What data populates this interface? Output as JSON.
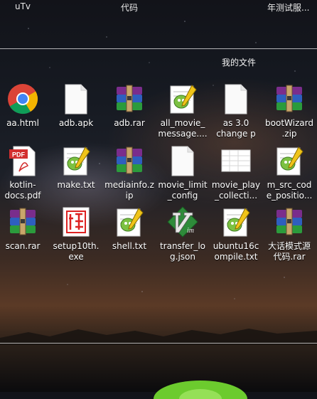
{
  "top": {
    "left_label": "uTv",
    "center_label": "代码",
    "right_label": "年测试服..."
  },
  "folder": {
    "title": "我的文件"
  },
  "files": [
    {
      "label": "aa.html",
      "icon": "chrome-icon"
    },
    {
      "label": "adb.apk",
      "icon": "document-icon"
    },
    {
      "label": "adb.rar",
      "icon": "winrar-icon"
    },
    {
      "label": "all_movie_message....",
      "icon": "notepadpp-icon"
    },
    {
      "label": "as 3.0 change p",
      "icon": "document-icon"
    },
    {
      "label": "bootWizard.zip",
      "icon": "winrar-icon"
    },
    {
      "label": "kotlin-docs.pdf",
      "icon": "pdf-icon"
    },
    {
      "label": "make.txt",
      "icon": "notepadpp-icon"
    },
    {
      "label": "mediainfo.zip",
      "icon": "winrar-icon"
    },
    {
      "label": "movie_limit_config",
      "icon": "document-icon"
    },
    {
      "label": "movie_play_collecti...",
      "icon": "spreadsheet-icon"
    },
    {
      "label": "m_src_code_positio...",
      "icon": "notepadpp-icon"
    },
    {
      "label": "scan.rar",
      "icon": "winrar-icon"
    },
    {
      "label": "setup10th.exe",
      "icon": "seal-icon"
    },
    {
      "label": "shell.txt",
      "icon": "notepadpp-icon"
    },
    {
      "label": "transfer_log.json",
      "icon": "vim-icon"
    },
    {
      "label": "ubuntu16compile.txt",
      "icon": "notepadpp-icon"
    },
    {
      "label": "大话模式源代码.rar",
      "icon": "winrar-icon"
    }
  ],
  "colors": {
    "chrome_red": "#DB4437",
    "chrome_green": "#0F9D58",
    "chrome_yellow": "#F4B400",
    "chrome_blue": "#4285F4",
    "pdf_red": "#D32F2F",
    "vim_green": "#2E8B3A",
    "tent_green": "#6CCB2E"
  }
}
